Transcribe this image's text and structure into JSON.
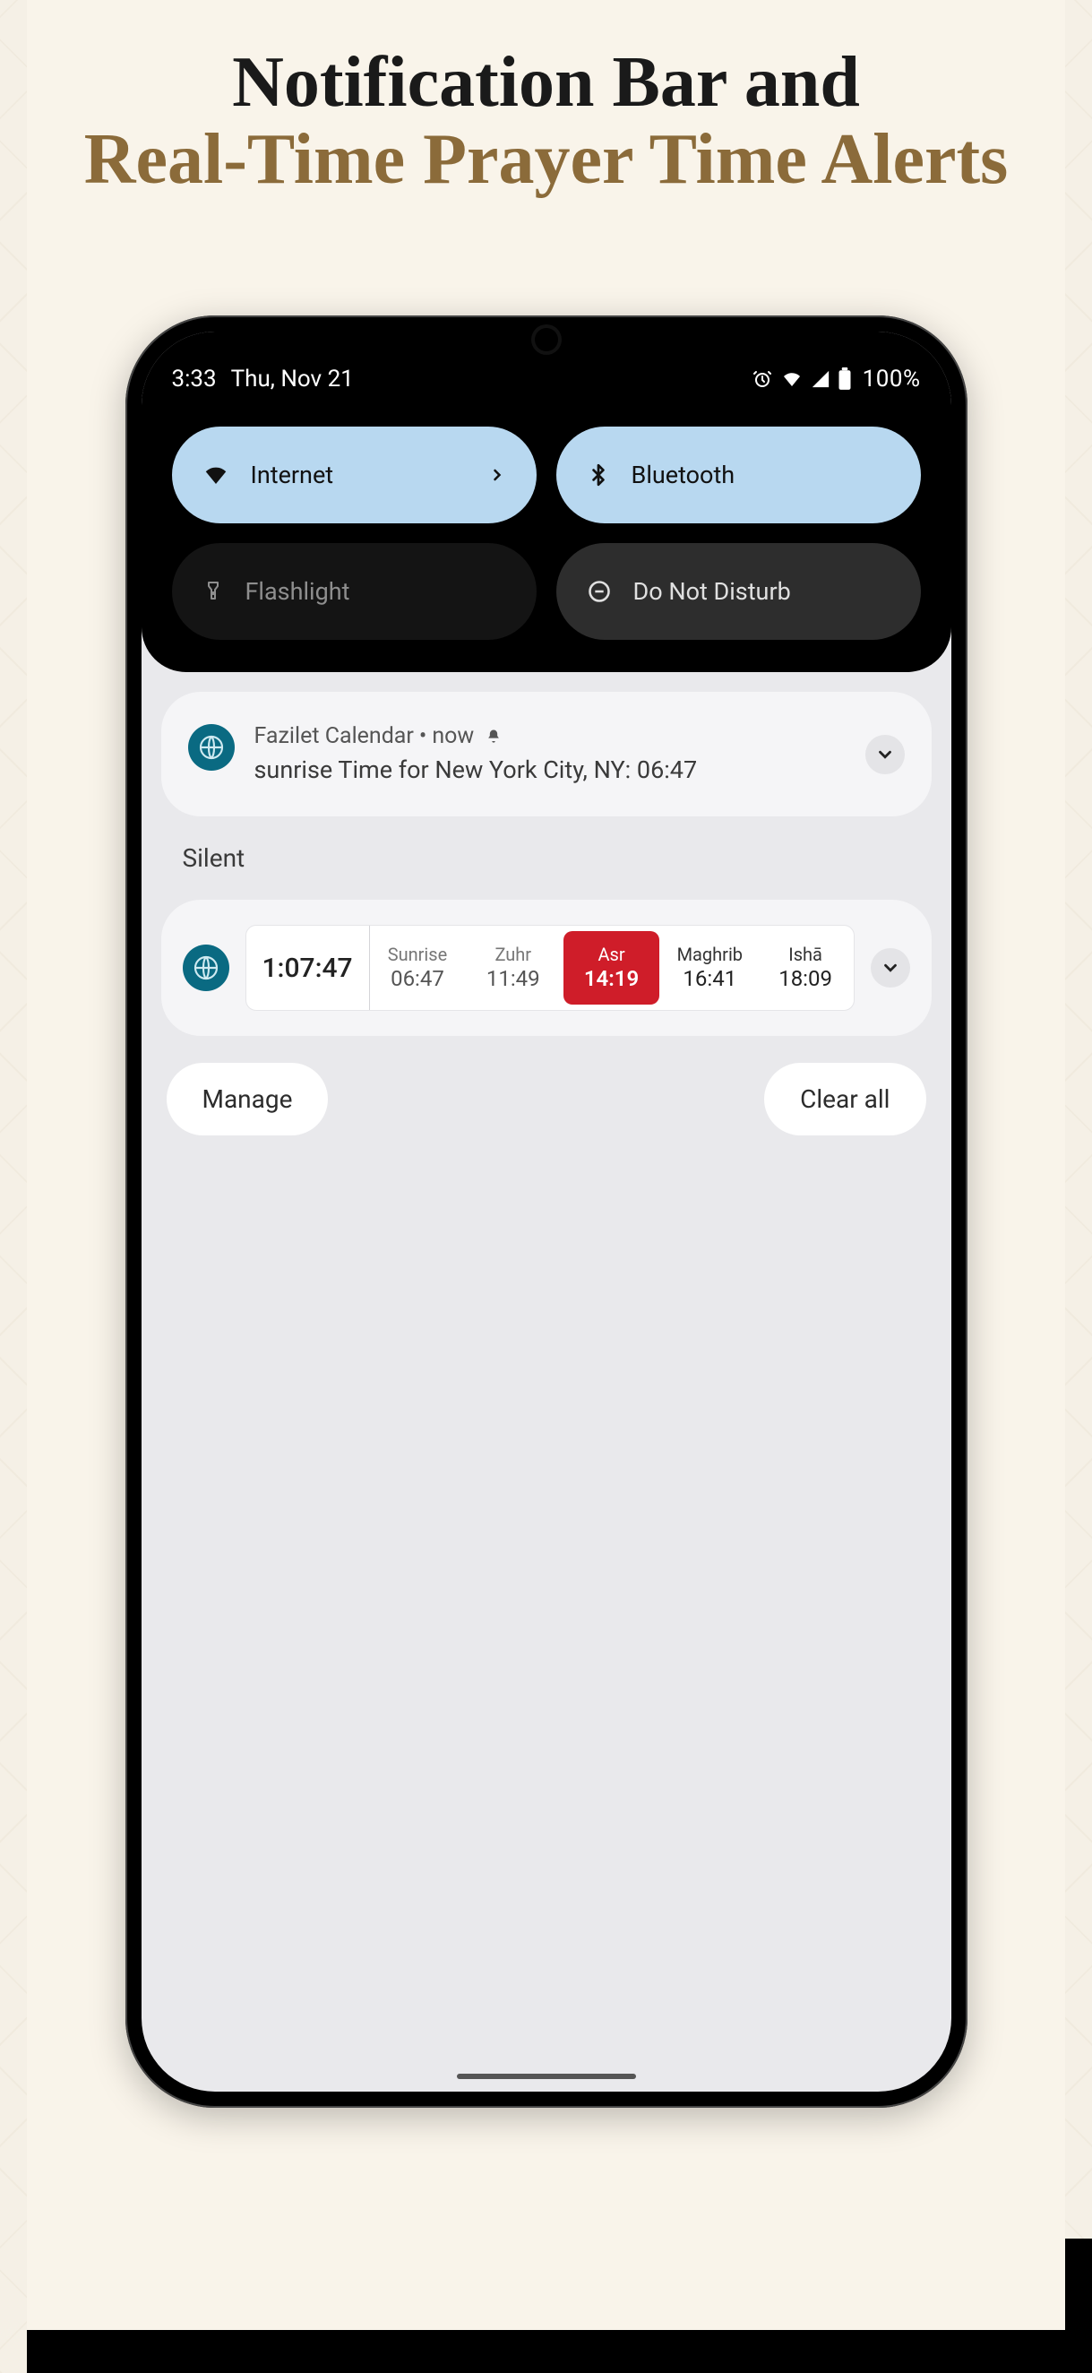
{
  "title": {
    "line1": "Notification Bar and",
    "line2": "Real-Time Prayer Time Alerts"
  },
  "status": {
    "time": "3:33",
    "date": "Thu, Nov 21",
    "battery": "100%"
  },
  "qs": {
    "internet": "Internet",
    "bluetooth": "Bluetooth",
    "flashlight": "Flashlight",
    "dnd": "Do Not Disturb"
  },
  "notif1": {
    "app": "Fazilet Calendar",
    "when": "now",
    "body": "sunrise Time for New York City, NY: 06:47"
  },
  "silent_label": "Silent",
  "widget": {
    "countdown": "1:07:47",
    "times": [
      {
        "name": "Sunrise",
        "time": "06:47",
        "style": "faded"
      },
      {
        "name": "Zuhr",
        "time": "11:49",
        "style": "faded"
      },
      {
        "name": "Asr",
        "time": "14:19",
        "style": "active"
      },
      {
        "name": "Maghrib",
        "time": "16:41",
        "style": "secondary"
      },
      {
        "name": "Ishā",
        "time": "18:09",
        "style": "secondary"
      }
    ]
  },
  "footer": {
    "manage": "Manage",
    "clear": "Clear all"
  }
}
